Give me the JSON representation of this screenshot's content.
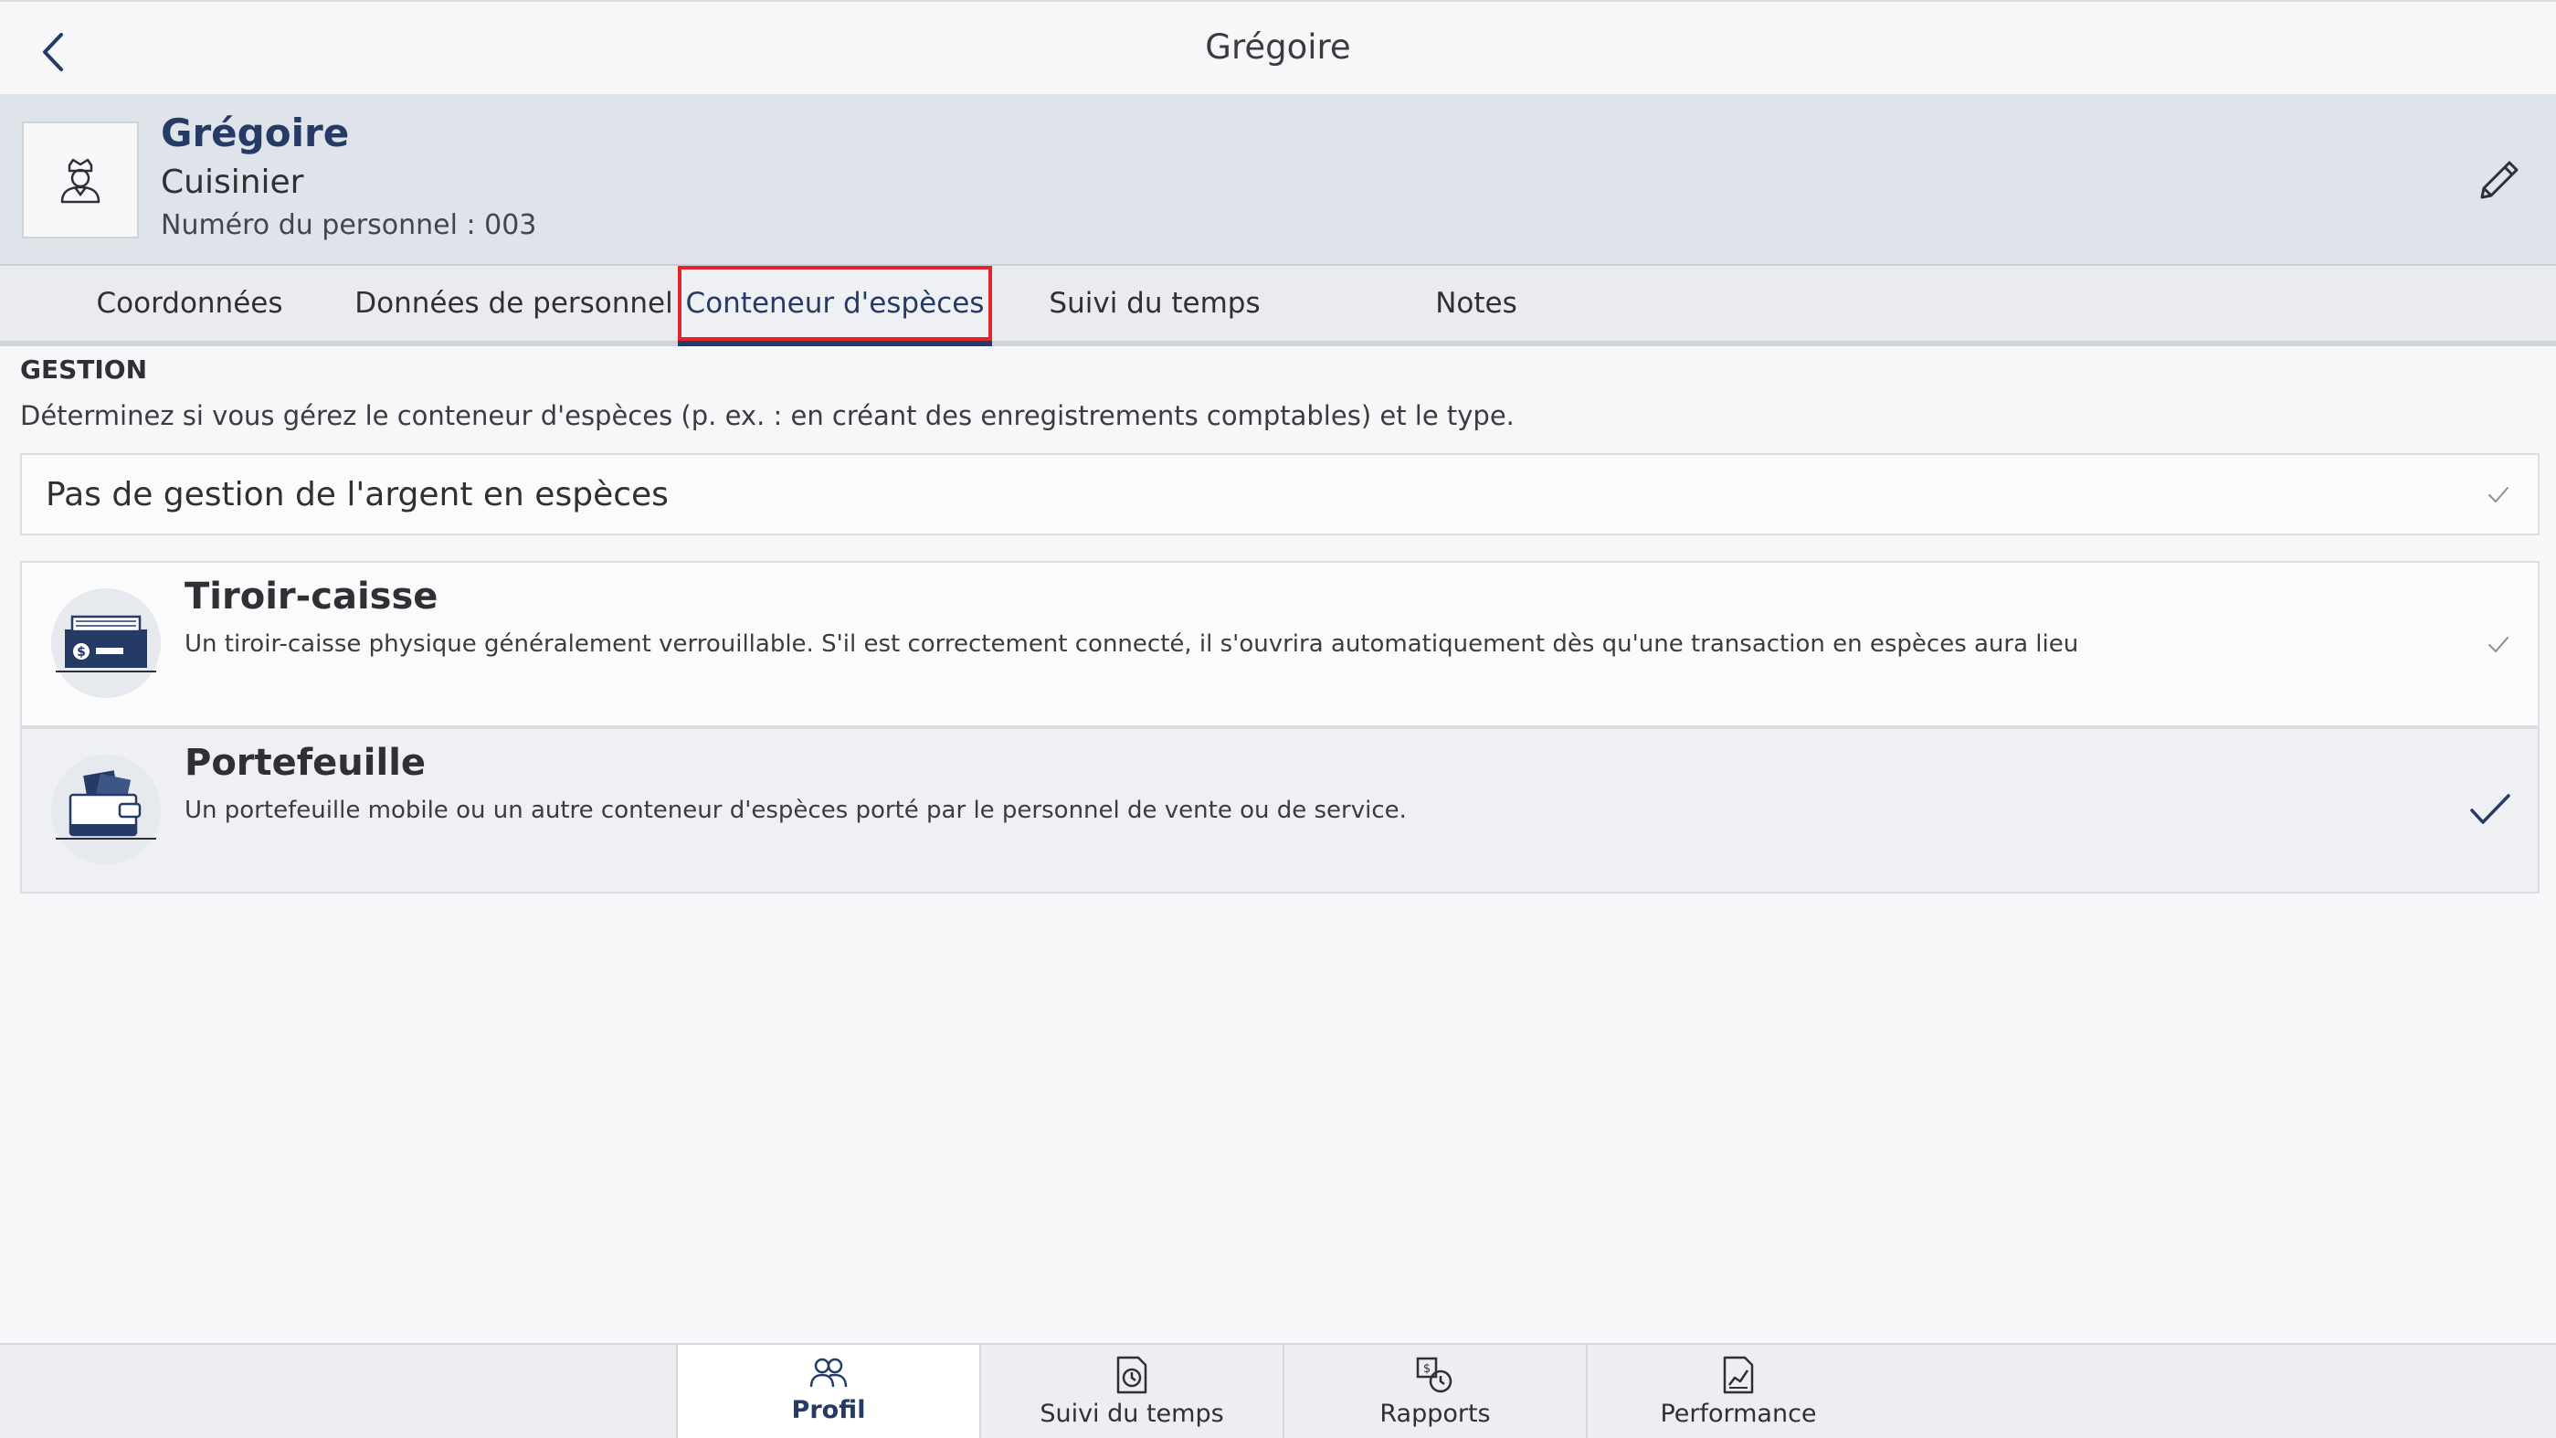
{
  "top_bar": {
    "title": "Grégoire"
  },
  "profile": {
    "name": "Grégoire",
    "role": "Cuisinier",
    "number": "Numéro du personnel : 003"
  },
  "tabs": [
    {
      "label": "Coordonnées"
    },
    {
      "label": "Données de personnel"
    },
    {
      "label": "Conteneur d'espèces"
    },
    {
      "label": "Suivi du temps"
    },
    {
      "label": "Notes"
    }
  ],
  "active_tab": "Conteneur d'espèces",
  "section": {
    "label": "GESTION",
    "description": "Déterminez si vous gérez le conteneur d'espèces (p. ex. : en créant des enregistrements comptables) et le type."
  },
  "options": {
    "none": {
      "label": "Pas de gestion de l'argent en espèces"
    },
    "cards": [
      {
        "title": "Tiroir-caisse",
        "description": "Un tiroir-caisse physique généralement verrouillable. S'il est correctement connecté, il s'ouvrira automatiquement dès qu'une transaction en espèces aura lieu",
        "icon": "cash-drawer-icon"
      },
      {
        "title": "Portefeuille",
        "description": "Un portefeuille mobile ou un autre conteneur d'espèces porté par le personnel de vente ou de service.",
        "icon": "wallet-icon",
        "selected": true
      }
    ]
  },
  "bottom_nav": [
    {
      "label": "Profil",
      "icon": "people-icon",
      "active": true
    },
    {
      "label": "Suivi du temps",
      "icon": "clock-document-icon"
    },
    {
      "label": "Rapports",
      "icon": "reports-icon"
    },
    {
      "label": "Performance",
      "icon": "chart-document-icon"
    }
  ],
  "colors": {
    "accent": "#253b66",
    "highlight_border": "#e0262b",
    "header_bg": "#dfe3ea"
  }
}
